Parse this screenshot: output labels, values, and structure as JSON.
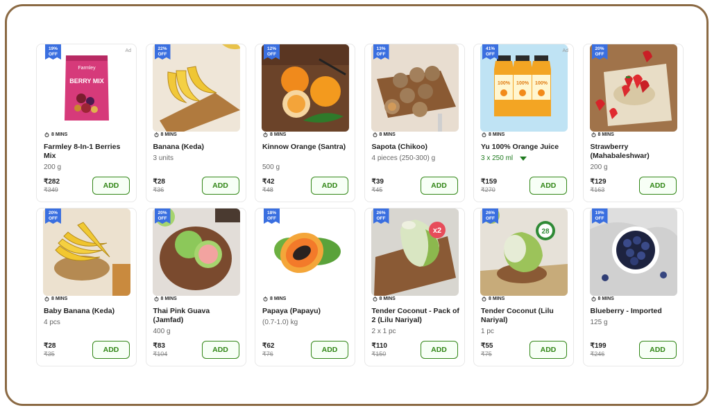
{
  "colors": {
    "frame": "#8b6a44",
    "badge": "#3a6fe0",
    "add_green": "#318616"
  },
  "eta_icon": "stopwatch-icon",
  "products": [
    {
      "discount": "19%",
      "off": "OFF",
      "ad": "Ad",
      "eta": "8 MINS",
      "name": "Farmley 8-In-1 Berries Mix",
      "unit": "200 g",
      "price": "₹282",
      "mrp": "₹349",
      "add": "ADD",
      "pack_text": "Farmley",
      "pack_title": "BERRY MIX"
    },
    {
      "discount": "22%",
      "off": "OFF",
      "eta": "8 MINS",
      "name": "Banana (Keda)",
      "unit": "3 units",
      "price": "₹28",
      "mrp": "₹36",
      "add": "ADD"
    },
    {
      "discount": "12%",
      "off": "OFF",
      "eta": "8 MINS",
      "name": "Kinnow Orange (Santra)",
      "unit": "500 g",
      "price": "₹42",
      "mrp": "₹48",
      "add": "ADD"
    },
    {
      "discount": "13%",
      "off": "OFF",
      "eta": "8 MINS",
      "name": "Sapota (Chikoo)",
      "unit": "4 pieces (250-300) g",
      "price": "₹39",
      "mrp": "₹45",
      "add": "ADD"
    },
    {
      "discount": "41%",
      "off": "OFF",
      "ad": "Ad",
      "eta": "8 MINS",
      "name": "Yu 100% Orange Juice",
      "unit": "3 x 250 ml",
      "price": "₹159",
      "mrp": "₹270",
      "add": "ADD",
      "bottle_label": "100%"
    },
    {
      "discount": "20%",
      "off": "OFF",
      "eta": "8 MINS",
      "name": "Strawberry (Mahabaleshwar)",
      "unit": "200 g",
      "price": "₹129",
      "mrp": "₹163",
      "add": "ADD"
    },
    {
      "discount": "20%",
      "off": "OFF",
      "eta": "8 MINS",
      "name": "Baby Banana (Keda)",
      "unit": "4 pcs",
      "price": "₹28",
      "mrp": "₹35",
      "add": "ADD"
    },
    {
      "discount": "20%",
      "off": "OFF",
      "eta": "8 MINS",
      "name": "Thai Pink Guava (Jamfad)",
      "unit": "400 g",
      "price": "₹83",
      "mrp": "₹104",
      "add": "ADD"
    },
    {
      "discount": "18%",
      "off": "OFF",
      "eta": "8 MINS",
      "name": "Papaya (Papayu)",
      "unit": "(0.7-1.0) kg",
      "price": "₹62",
      "mrp": "₹76",
      "add": "ADD"
    },
    {
      "discount": "26%",
      "off": "OFF",
      "eta": "8 MINS",
      "name": "Tender Coconut - Pack of 2 (Lilu Nariyal)",
      "unit": "2 x 1 pc",
      "price": "₹110",
      "mrp": "₹150",
      "add": "ADD",
      "tag": "x2"
    },
    {
      "discount": "26%",
      "off": "OFF",
      "eta": "8 MINS",
      "name": "Tender Coconut (Lilu Nariyal)",
      "unit": "1 pc",
      "price": "₹55",
      "mrp": "₹75",
      "add": "ADD",
      "tag": "28"
    },
    {
      "discount": "19%",
      "off": "OFF",
      "eta": "8 MINS",
      "name": "Blueberry - Imported",
      "unit": "125 g",
      "price": "₹199",
      "mrp": "₹246",
      "add": "ADD"
    }
  ]
}
